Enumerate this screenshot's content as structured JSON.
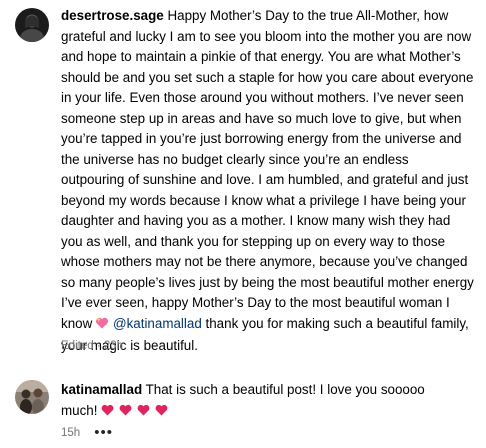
{
  "comments": [
    {
      "username": "desertrose.sage",
      "text": "Happy Mother’s Day to the true All-Mother, how grateful and lucky I am to see you bloom into the mother you are now and hope to maintain a pinkie of that energy. You are what Mother’s should be and you set such a staple for how you care about everyone in your life. Even those around you without mothers. I’ve never seen someone step up in areas and have so much love to give, but when you’re tapped in you’re just borrowing energy from the universe and the universe has no budget clearly since you’re an endless outpouring of sunshine and love. I am humbled, and grateful and just beyond my words because I know what a privilege I have being your daughter and having you as a mother. I know many wish they had you as well, and thank you for stepping up on every way to those whose mothers may not be there anymore, because you’ve changed so many people’s lives just by being the most beautiful mother energy I’ve ever seen, happy Mother’s Day to the most beautiful woman I know",
      "mention": "@katinamallad",
      "text_after_mention": "thank you for making such a beautiful family, your magic is beautiful.",
      "meta": "Edited · 23h",
      "icons": [
        "sparkling-heart-icon"
      ]
    },
    {
      "username": "katinamallad",
      "text": "That is such a beautiful post! I love you sooooo much!",
      "meta": "15h",
      "more": "•••",
      "icons": [
        "red-heart-icon",
        "red-heart-icon",
        "red-heart-icon",
        "red-heart-icon"
      ]
    }
  ],
  "colors": {
    "mention": "#00376b",
    "meta": "#737373",
    "heart": "#e0245e"
  }
}
